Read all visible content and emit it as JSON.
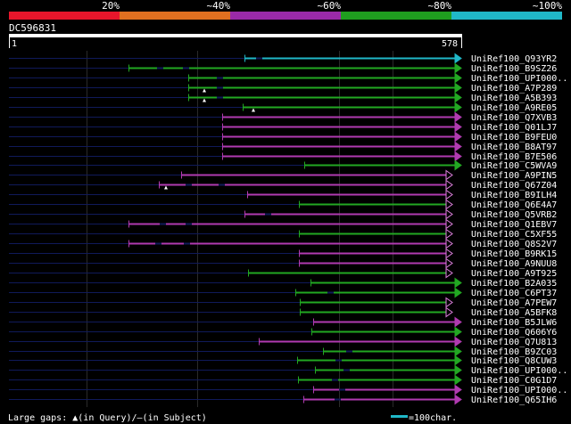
{
  "legend": {
    "labels": [
      "20%",
      "~40%",
      "~60%",
      "~80%",
      "~100%"
    ],
    "colors": [
      "#e8162b",
      "#e07020",
      "#9a2aa8",
      "#1f9e1f",
      "#20b8c8"
    ]
  },
  "query": {
    "name": "DC596831",
    "start": "1",
    "end": "578"
  },
  "colors": {
    "purple": "#b03ab0",
    "green": "#22a822",
    "cyan": "#20b8c8",
    "backbone": "#101a5a",
    "grid": "#2a2a2a"
  },
  "hits": [
    {
      "id": "UniRef100_Q93YR2",
      "start": 274,
      "color": "cyan",
      "gaps": [
        287
      ]
    },
    {
      "id": "UniRef100_B9SZ26",
      "start": 144,
      "color": "green",
      "gaps": [
        176,
        205
      ]
    },
    {
      "id": "UniRef100_UPI000..",
      "start": 211,
      "color": "green",
      "gaps": [
        243
      ]
    },
    {
      "id": "UniRef100_A7P289",
      "start": 211,
      "color": "green",
      "gaps": [
        243
      ],
      "marker": 229
    },
    {
      "id": "UniRef100_A5B393",
      "start": 211,
      "color": "green",
      "gaps": [
        243
      ],
      "marker": 229
    },
    {
      "id": "UniRef100_A9RE05",
      "start": 272,
      "color": "green",
      "gaps": [],
      "marker": 284
    },
    {
      "id": "UniRef100_Q7XVB3",
      "start": 249,
      "color": "purple",
      "gaps": []
    },
    {
      "id": "UniRef100_Q01LJ7",
      "start": 249,
      "color": "purple",
      "gaps": []
    },
    {
      "id": "UniRef100_B9FEU0",
      "start": 249,
      "color": "purple",
      "gaps": []
    },
    {
      "id": "UniRef100_B8AT97",
      "start": 249,
      "color": "purple",
      "gaps": []
    },
    {
      "id": "UniRef100_B7E506",
      "start": 249,
      "color": "purple",
      "gaps": []
    },
    {
      "id": "UniRef100_C5WVA9",
      "start": 341,
      "color": "green",
      "gaps": []
    },
    {
      "id": "UniRef100_A9PIN5",
      "start": 203,
      "color": "purple",
      "gaps": [],
      "endShape": "open"
    },
    {
      "id": "UniRef100_Q67Z04",
      "start": 178,
      "color": "purple",
      "gaps": [
        208,
        245
      ],
      "marker": 186,
      "endShape": "open"
    },
    {
      "id": "UniRef100_B9ILH4",
      "start": 277,
      "color": "purple",
      "gaps": [],
      "endShape": "open"
    },
    {
      "id": "UniRef100_Q6E4A7",
      "start": 335,
      "color": "green",
      "gaps": [],
      "endShape": "open"
    },
    {
      "id": "UniRef100_Q5VRB2",
      "start": 274,
      "color": "purple",
      "gaps": [
        297
      ],
      "endShape": "open"
    },
    {
      "id": "UniRef100_Q1EBV7",
      "start": 144,
      "color": "purple",
      "gaps": [
        179,
        208
      ],
      "endShape": "open"
    },
    {
      "id": "UniRef100_C5XF55",
      "start": 335,
      "color": "green",
      "gaps": [],
      "endShape": "open"
    },
    {
      "id": "UniRef100_Q8S2V7",
      "start": 144,
      "color": "purple",
      "gaps": [
        174,
        206
      ],
      "endShape": "open"
    },
    {
      "id": "UniRef100_B9RK15",
      "start": 335,
      "color": "purple",
      "gaps": [],
      "endShape": "open"
    },
    {
      "id": "UniRef100_A9NUU8",
      "start": 335,
      "color": "purple",
      "gaps": [],
      "endShape": "open"
    },
    {
      "id": "UniRef100_A9T925",
      "start": 278,
      "color": "green",
      "gaps": [],
      "endShape": "open"
    },
    {
      "id": "UniRef100_B2A035",
      "start": 348,
      "color": "green",
      "gaps": []
    },
    {
      "id": "UniRef100_C6PT37",
      "start": 331,
      "color": "green",
      "gaps": [
        367
      ]
    },
    {
      "id": "UniRef100_A7PEW7",
      "start": 336,
      "color": "green",
      "gaps": [],
      "endShape": "open"
    },
    {
      "id": "UniRef100_A5BFK8",
      "start": 336,
      "color": "green",
      "gaps": [],
      "endShape": "open"
    },
    {
      "id": "UniRef100_B5JLW6",
      "start": 351,
      "color": "purple",
      "gaps": []
    },
    {
      "id": "UniRef100_Q606Y6",
      "start": 349,
      "color": "green",
      "gaps": []
    },
    {
      "id": "UniRef100_Q7U813",
      "start": 290,
      "color": "purple",
      "gaps": []
    },
    {
      "id": "UniRef100_B9ZC03",
      "start": 362,
      "color": "green",
      "gaps": [
        388
      ]
    },
    {
      "id": "UniRef100_Q8CUW3",
      "start": 333,
      "color": "green",
      "gaps": [
        376
      ]
    },
    {
      "id": "UniRef100_UPI000..",
      "start": 353,
      "color": "green",
      "gaps": [
        385
      ]
    },
    {
      "id": "UniRef100_C0G1D7",
      "start": 334,
      "color": "green",
      "gaps": [
        372
      ]
    },
    {
      "id": "UniRef100_UPI000..",
      "start": 351,
      "color": "purple",
      "gaps": [
        380
      ]
    },
    {
      "id": "UniRef100_Q65IH6",
      "start": 340,
      "color": "purple",
      "gaps": [
        375
      ]
    }
  ],
  "footer": {
    "gaps_label": "Large gaps: ",
    "gaps_query": "(in Query)/",
    "gaps_dash": "–",
    "gaps_subject": "(in Subject)",
    "scale_label": "=100char."
  }
}
